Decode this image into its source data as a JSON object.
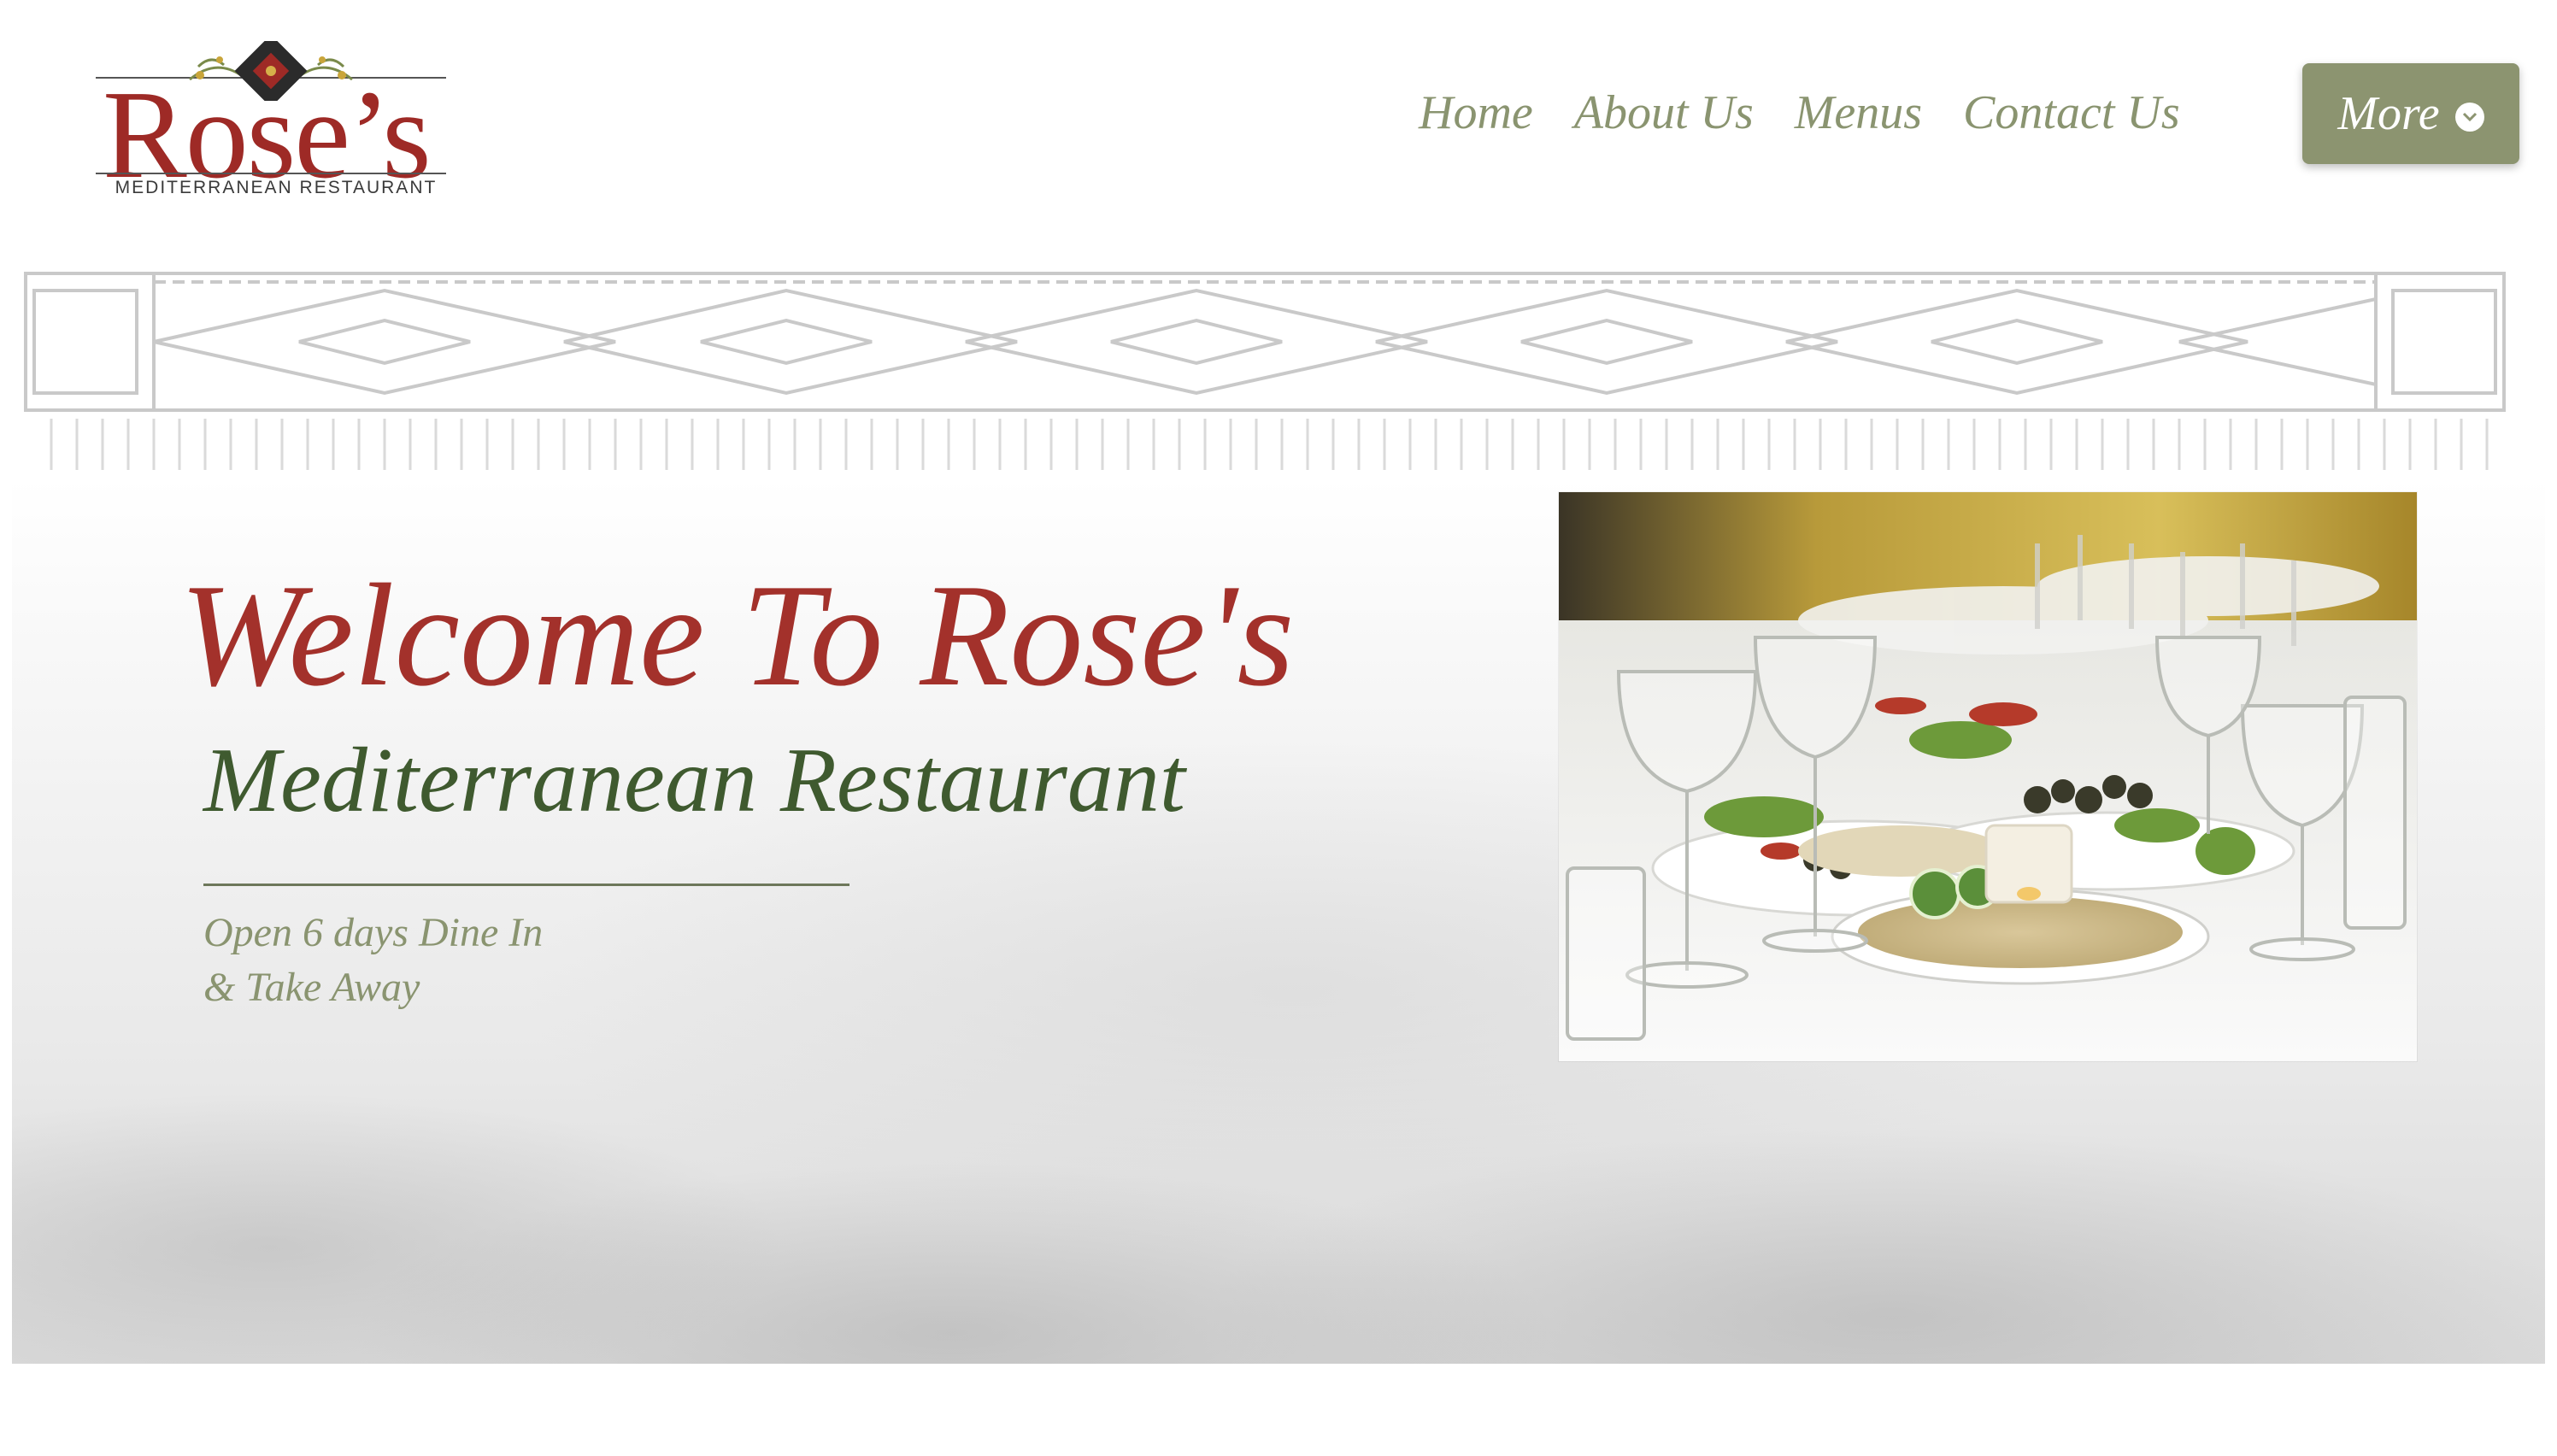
{
  "logo": {
    "word": "Rose’s",
    "subtitle": "MEDITERRANEAN RESTAURANT",
    "brand_red": "#9e2a26"
  },
  "nav": {
    "items": [
      {
        "label": "Home"
      },
      {
        "label": "About Us"
      },
      {
        "label": "Menus"
      },
      {
        "label": "Contact Us"
      }
    ],
    "more_label": "More",
    "more_icon": "chevron-down-icon",
    "more_bg": "#8c9470",
    "text_color": "#8a9470"
  },
  "hero": {
    "title": "Welcome To Rose's",
    "subtitle": "Mediterranean Restaurant",
    "tagline_line1": "Open 6 days Dine In",
    "tagline_line2": "& Take Away",
    "title_color": "#a3312b",
    "subtitle_color": "#3f5a2f"
  }
}
